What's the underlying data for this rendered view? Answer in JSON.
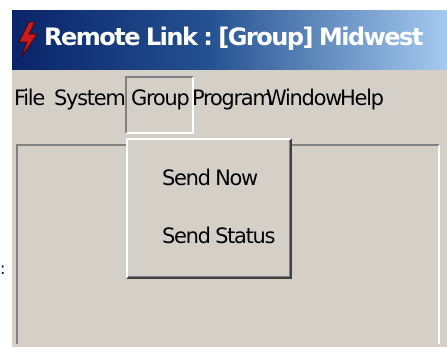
{
  "window": {
    "title": "Remote Link : [Group] Midwest",
    "icon": "red-lightning-bolt-icon",
    "titlebar_colors": [
      "#0a246a",
      "#a6caf0"
    ]
  },
  "menubar": {
    "items": [
      {
        "label": "File"
      },
      {
        "label": "System"
      },
      {
        "label": "Group",
        "open": true
      },
      {
        "label": "Program"
      },
      {
        "label": "Window"
      },
      {
        "label": "Help"
      }
    ]
  },
  "group_menu": {
    "items": [
      {
        "label": "Send Now"
      },
      {
        "label": "Send Status"
      }
    ]
  },
  "edge_glyph": ":"
}
